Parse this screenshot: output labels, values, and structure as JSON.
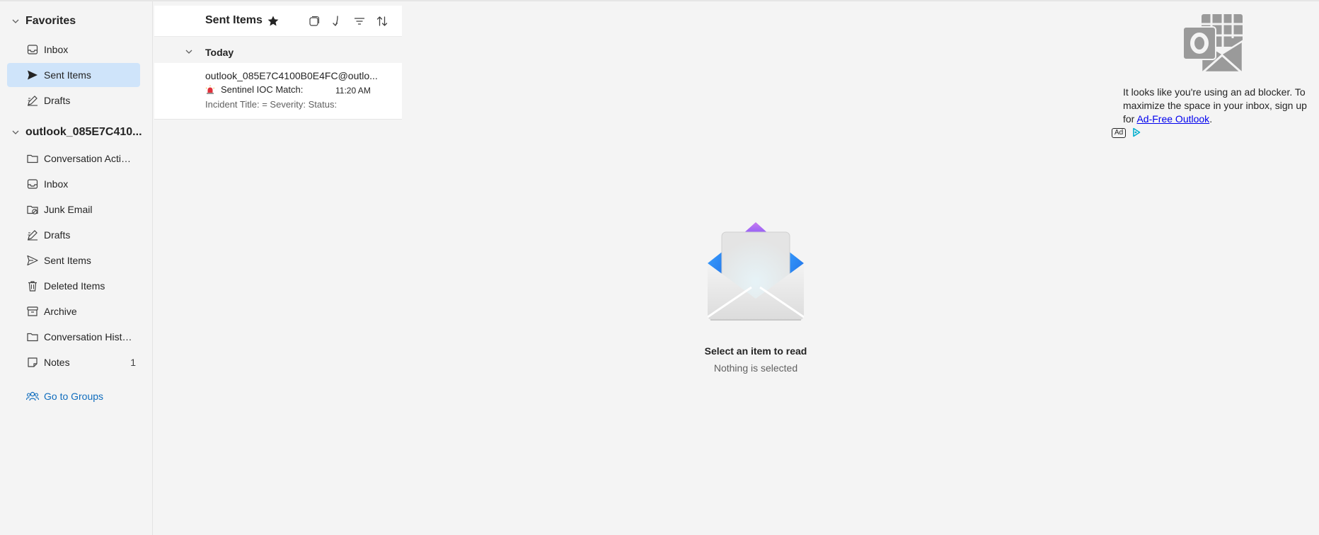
{
  "sidebar": {
    "favorites_label": "Favorites",
    "favorites": [
      {
        "label": "Inbox"
      },
      {
        "label": "Sent Items"
      },
      {
        "label": "Drafts"
      }
    ],
    "account_label": "outlook_085E7C410...",
    "folders": [
      {
        "label": "Conversation Actio..."
      },
      {
        "label": "Inbox"
      },
      {
        "label": "Junk Email"
      },
      {
        "label": "Drafts"
      },
      {
        "label": "Sent Items"
      },
      {
        "label": "Deleted Items"
      },
      {
        "label": "Archive"
      },
      {
        "label": "Conversation Histo..."
      },
      {
        "label": "Notes",
        "count": "1"
      }
    ],
    "go_to_groups": "Go to Groups"
  },
  "message_list": {
    "title": "Sent Items",
    "group_label": "Today",
    "messages": [
      {
        "from": "outlook_085E7C4100B0E4FC@outlo...",
        "subject": "Sentinel IOC Match:",
        "time": "11:20 AM",
        "preview": "Incident Title: = Severity: Status:"
      }
    ]
  },
  "reading_pane": {
    "title": "Select an item to read",
    "subtitle": "Nothing is selected"
  },
  "ad": {
    "text_before": "It looks like you're using an ad blocker. To maximize the space in your inbox, sign up for ",
    "link_text": "Ad-Free Outlook",
    "text_after": ".",
    "badge": "Ad"
  },
  "colors": {
    "selected_bg": "#cfe4fa",
    "link": "#0f6cbd"
  }
}
